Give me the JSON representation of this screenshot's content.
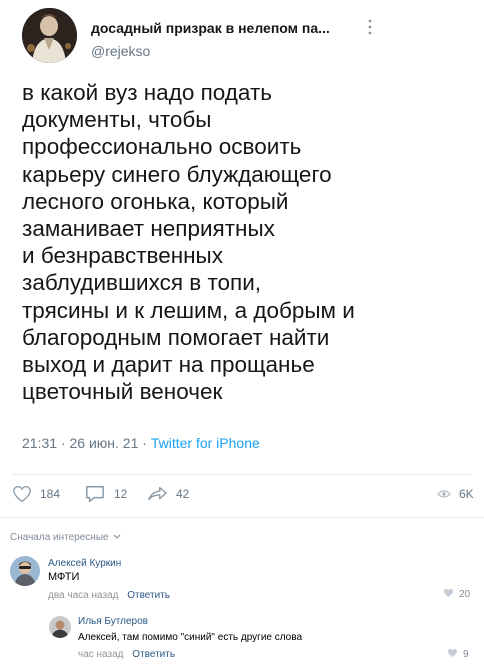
{
  "tweet": {
    "author_name": "досадный призрак в нелепом па...",
    "author_handle": "@rejekso",
    "text_lines": [
      "в какой вуз надо подать",
      "документы, чтобы",
      "профессионально освоить",
      "карьеру синего блуждающего",
      "лесного огонька, который",
      "заманивает неприятных",
      "и безнравственных",
      "заблудившихся в топи,",
      "трясины и к лешим, а добрым и",
      "благородным помогает найти",
      "выход и дарит на прощанье",
      "цветочный веночек"
    ],
    "time": "21:31",
    "date": "26 июн. 21",
    "source": "Twitter for iPhone",
    "separator": "·",
    "likes": "184",
    "replies": "12",
    "retweets": "42",
    "views": "6K"
  },
  "comments_section": {
    "sort_label": "Сначала интересные"
  },
  "comments": [
    {
      "author": "Алексей Куркин",
      "text": "МФТИ",
      "time": "два часа назад",
      "reply_label": "Ответить",
      "likes": "20"
    },
    {
      "author": "Илья Бутлеров",
      "text": "Алексей, там помимо \"синий\" есть другие слова",
      "time": "час назад",
      "reply_label": "Ответить",
      "likes": "9"
    }
  ],
  "icons": {
    "more": "more-vertical-icon",
    "like": "heart-icon",
    "reply": "speech-bubble-icon",
    "share": "share-arrow-icon",
    "views": "eye-icon",
    "sort": "chevron-down-icon",
    "comment_like": "heart-icon"
  },
  "colors": {
    "link_blue": "#1da1f2",
    "vk_link": "#2a5885",
    "muted": "#657786"
  }
}
